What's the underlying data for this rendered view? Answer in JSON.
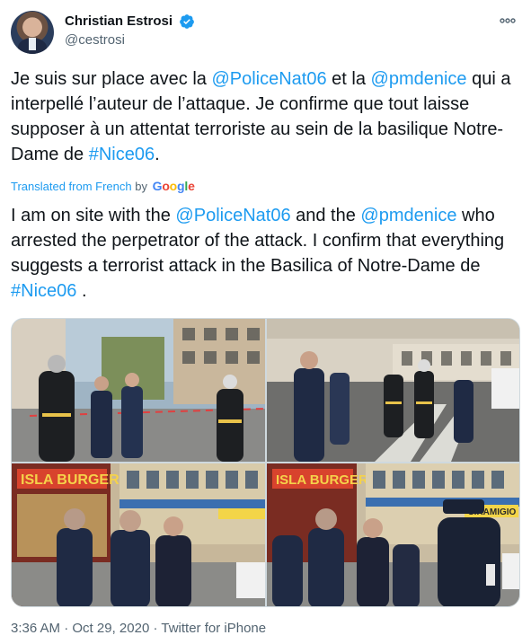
{
  "author": {
    "display_name": "Christian Estrosi",
    "handle": "@cestrosi",
    "verified": true,
    "avatar_icon": "profile-photo"
  },
  "more_icon": "ellipsis-icon",
  "original_text": {
    "segments": [
      {
        "text": "Je suis sur place avec la ",
        "type": "text"
      },
      {
        "text": "@PoliceNat06",
        "type": "mention"
      },
      {
        "text": " et la ",
        "type": "text"
      },
      {
        "text": "@pmdenice",
        "type": "mention"
      },
      {
        "text": " qui a interpellé l’auteur de l’attaque. Je confirme que tout laisse supposer à un attentat terroriste au sein de la basilique Notre-Dame de ",
        "type": "text"
      },
      {
        "text": "#Nice06",
        "type": "hashtag"
      },
      {
        "text": ".",
        "type": "text"
      }
    ]
  },
  "translation": {
    "label": "Translated from French",
    "by": "by",
    "provider_letters": [
      "G",
      "o",
      "o",
      "g",
      "l",
      "e"
    ]
  },
  "translated_text": {
    "segments": [
      {
        "text": "I am on site with the ",
        "type": "text"
      },
      {
        "text": "@PoliceNat06",
        "type": "mention"
      },
      {
        "text": " and the ",
        "type": "text"
      },
      {
        "text": "@pmdenice",
        "type": "mention"
      },
      {
        "text": " who arrested the perpetrator of the attack. I confirm that everything suggests a terrorist attack in the Basilica of Notre-Dame de ",
        "type": "text"
      },
      {
        "text": "#Nice06",
        "type": "hashtag"
      },
      {
        "text": " .",
        "type": "text"
      }
    ]
  },
  "media": {
    "photos": [
      {
        "name": "photo-street-firefighters"
      },
      {
        "name": "photo-crossing-police"
      },
      {
        "name": "photo-burger-shop-officers",
        "sign_text": "ISLA BURGER"
      },
      {
        "name": "photo-officers-close",
        "sign_text": "ISLA BURGER"
      }
    ],
    "shop_sign": "SIRAMIGIO"
  },
  "footer": {
    "time": "3:36 AM",
    "separator": "·",
    "date": "Oct 29, 2020",
    "source": "Twitter for iPhone"
  },
  "colors": {
    "link": "#1d9bf0",
    "verified": "#1d9bf0",
    "secondary_text": "#536471",
    "primary_text": "#0f1419"
  }
}
